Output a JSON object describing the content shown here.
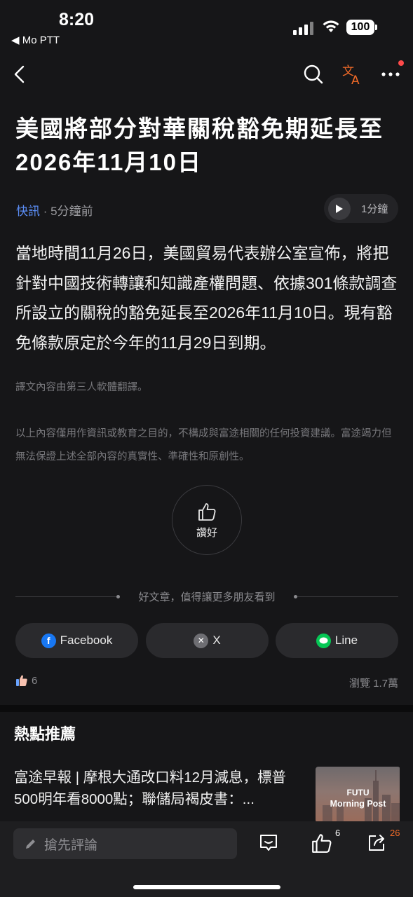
{
  "status_bar": {
    "time": "8:20",
    "back_app": "◀ Mo PTT",
    "battery": "100"
  },
  "nav": {
    "back_icon": "chevron-left-icon",
    "search_icon": "search-icon",
    "translate_icon": "translate-icon",
    "more_icon": "more-icon",
    "accent_color": "#f26b28"
  },
  "article": {
    "title": "美國將部分對華關稅豁免期延長至2026年11月10日",
    "tag": "快訊",
    "separator": " · ",
    "time_ago": "5分鐘前",
    "listen_duration": "1分鐘",
    "body": "當地時間11月26日，美國貿易代表辦公室宣佈，將把針對中國技術轉讓和知識產權問題、依據301條款調查所設立的關稅的豁免延長至2026年11月10日。現有豁免條款原定於今年的11月29日到期。",
    "translation_note": "譯文內容由第三人軟體翻譯。",
    "disclaimer": "以上內容僅用作資訊或教育之目的，不構成與富途相關的任何投資建議。富途竭力但無法保證上述全部內容的真實性、準確性和原創性。"
  },
  "like_button": {
    "label": "讚好"
  },
  "share": {
    "prompt": "好文章，值得讓更多朋友看到",
    "buttons": [
      {
        "label": "Facebook",
        "color": "#1877f2",
        "icon": "facebook-icon"
      },
      {
        "label": "X",
        "color": "#6e6e73",
        "icon": "x-icon"
      },
      {
        "label": "Line",
        "color": "#06c755",
        "icon": "line-icon"
      }
    ]
  },
  "stats": {
    "likes": "6",
    "views": "瀏覽  1.7萬"
  },
  "recommend": {
    "title": "熱點推薦",
    "items": [
      {
        "text": "富途早報 | 摩根大通改口料12月減息，標普500明年看8000點；聯儲局褐皮書：...",
        "thumb_line1": "FUTU",
        "thumb_line2": "Morning Post"
      }
    ]
  },
  "bottom_bar": {
    "comment_placeholder": "搶先評論",
    "like_count": "6",
    "share_count": "26"
  }
}
